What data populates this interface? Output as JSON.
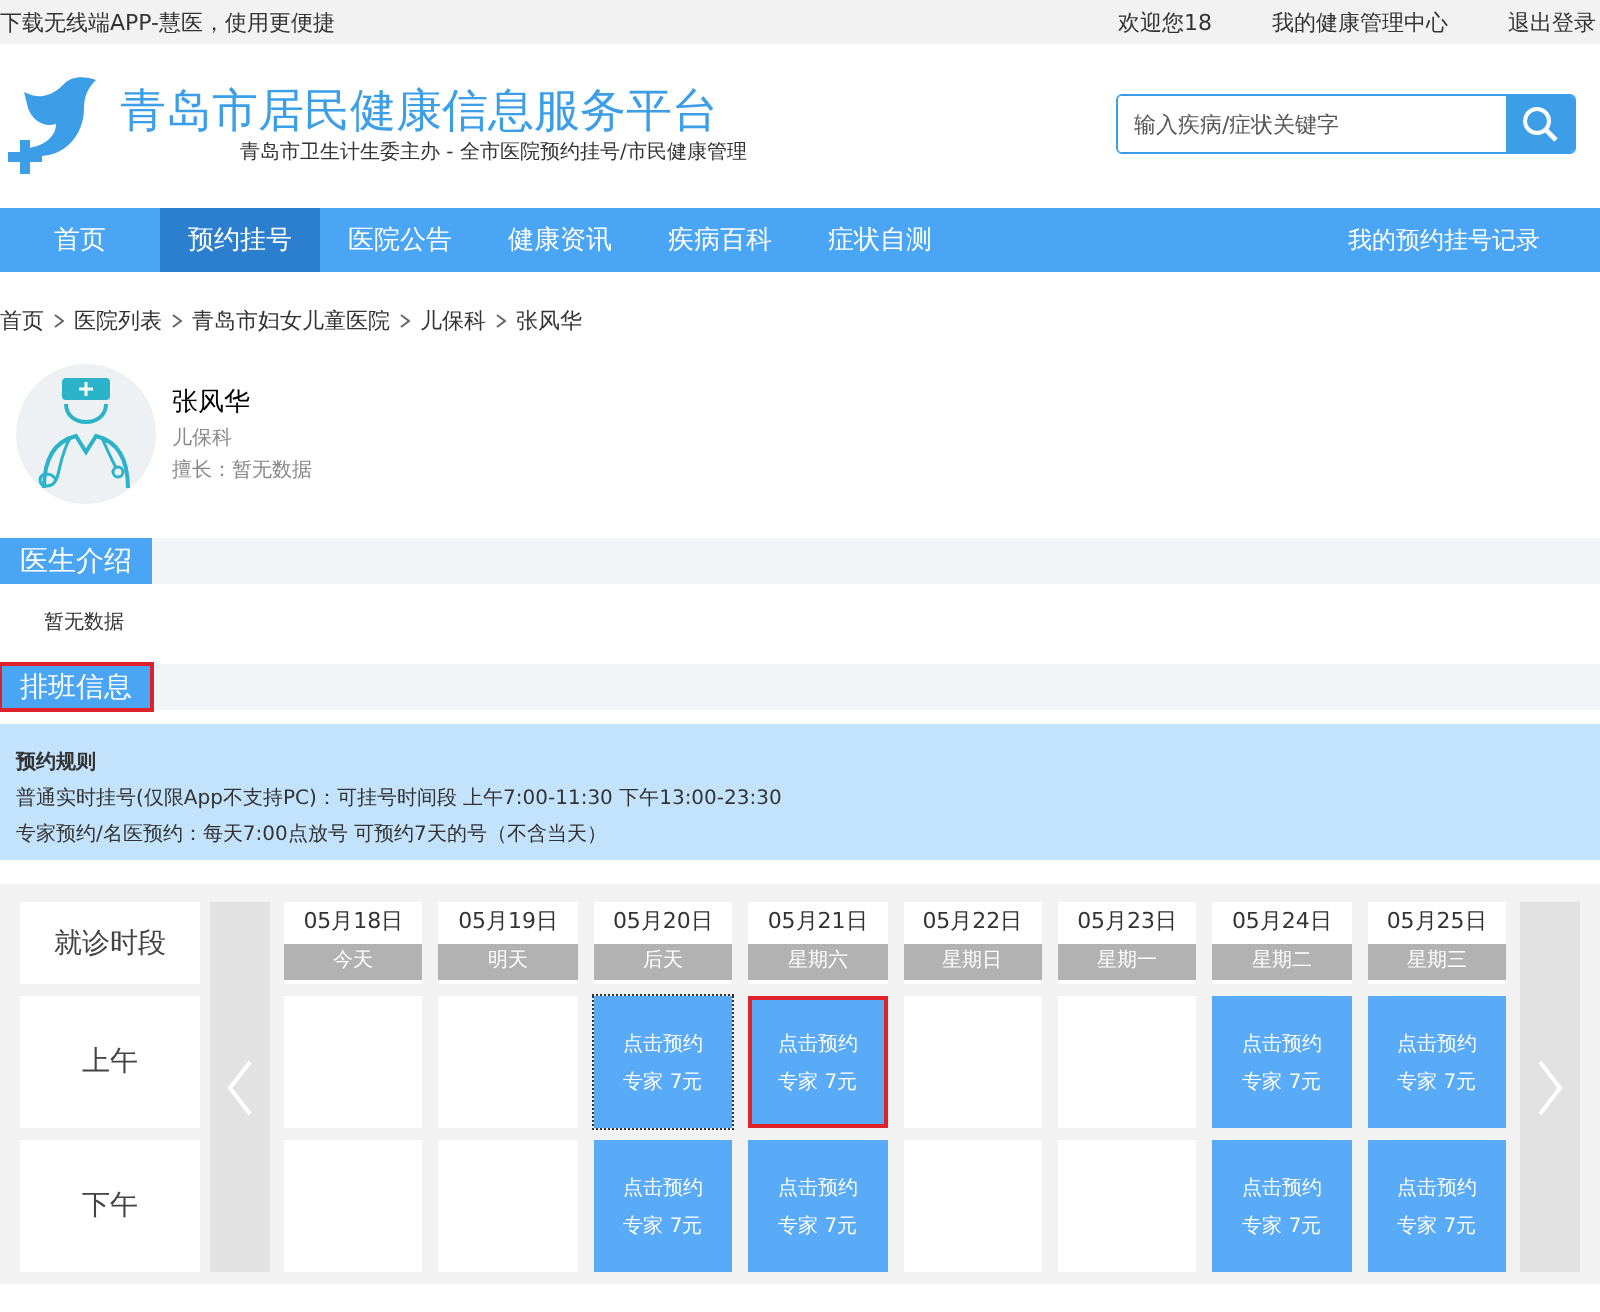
{
  "top_bar": {
    "promo": "下载无线端APP-慧医，使用更便捷",
    "welcome": "欢迎您18",
    "links": [
      "我的健康管理中心",
      "退出登录"
    ]
  },
  "header": {
    "title": "青岛市居民健康信息服务平台",
    "subtitle": "青岛市卫生计生委主办 - 全市医院预约挂号/市民健康管理",
    "search": {
      "placeholder": "输入疾病/症状关键字"
    }
  },
  "nav": {
    "items": [
      {
        "label": "首页",
        "selected": false
      },
      {
        "label": "预约挂号",
        "selected": true
      },
      {
        "label": "医院公告",
        "selected": false
      },
      {
        "label": "健康资讯",
        "selected": false
      },
      {
        "label": "疾病百科",
        "selected": false
      },
      {
        "label": "症状自测",
        "selected": false
      }
    ],
    "right_link": "我的预约挂号记录"
  },
  "breadcrumb": [
    "首页",
    "医院列表",
    "青岛市妇女儿童医院",
    "儿保科",
    "张风华"
  ],
  "doctor": {
    "name": "张风华",
    "department": "儿保科",
    "specialty": "擅长：暂无数据"
  },
  "intro": {
    "title": "医生介绍",
    "highlighted": false,
    "text": "暂无数据"
  },
  "schedule_section": {
    "title": "排班信息",
    "highlighted": true
  },
  "rules": {
    "title": "预约规则",
    "lines": [
      "普通实时挂号(仅限App不支持PC)：可挂号时间段 上午7:00-11:30 下午13:00-23:30",
      "专家预约/名医预约：每天7:00点放号 可预约7天的号（不含当天）"
    ]
  },
  "schedule": {
    "corner": "就诊时段",
    "days": [
      {
        "date": "05月18日",
        "weekday": "今天"
      },
      {
        "date": "05月19日",
        "weekday": "明天"
      },
      {
        "date": "05月20日",
        "weekday": "后天"
      },
      {
        "date": "05月21日",
        "weekday": "星期六"
      },
      {
        "date": "05月22日",
        "weekday": "星期日"
      },
      {
        "date": "05月23日",
        "weekday": "星期一"
      },
      {
        "date": "05月24日",
        "weekday": "星期二"
      },
      {
        "date": "05月25日",
        "weekday": "星期三"
      }
    ],
    "rows": [
      {
        "label": "上午",
        "cells": [
          {
            "kind": "empty"
          },
          {
            "kind": "empty"
          },
          {
            "kind": "bookable",
            "action": "点击预约",
            "price": "专家 7元",
            "focused": true,
            "highlighted": false
          },
          {
            "kind": "bookable",
            "action": "点击预约",
            "price": "专家 7元",
            "focused": false,
            "highlighted": true
          },
          {
            "kind": "empty"
          },
          {
            "kind": "empty"
          },
          {
            "kind": "bookable",
            "action": "点击预约",
            "price": "专家 7元",
            "focused": false,
            "highlighted": false
          },
          {
            "kind": "bookable",
            "action": "点击预约",
            "price": "专家 7元",
            "focused": false,
            "highlighted": false
          }
        ]
      },
      {
        "label": "下午",
        "cells": [
          {
            "kind": "empty"
          },
          {
            "kind": "empty"
          },
          {
            "kind": "bookable",
            "action": "点击预约",
            "price": "专家 7元",
            "focused": false,
            "highlighted": false
          },
          {
            "kind": "bookable",
            "action": "点击预约",
            "price": "专家 7元",
            "focused": false,
            "highlighted": false
          },
          {
            "kind": "empty"
          },
          {
            "kind": "empty"
          },
          {
            "kind": "bookable",
            "action": "点击预约",
            "price": "专家 7元",
            "focused": false,
            "highlighted": false
          },
          {
            "kind": "bookable",
            "action": "点击预约",
            "price": "专家 7元",
            "focused": false,
            "highlighted": false
          }
        ]
      }
    ]
  }
}
